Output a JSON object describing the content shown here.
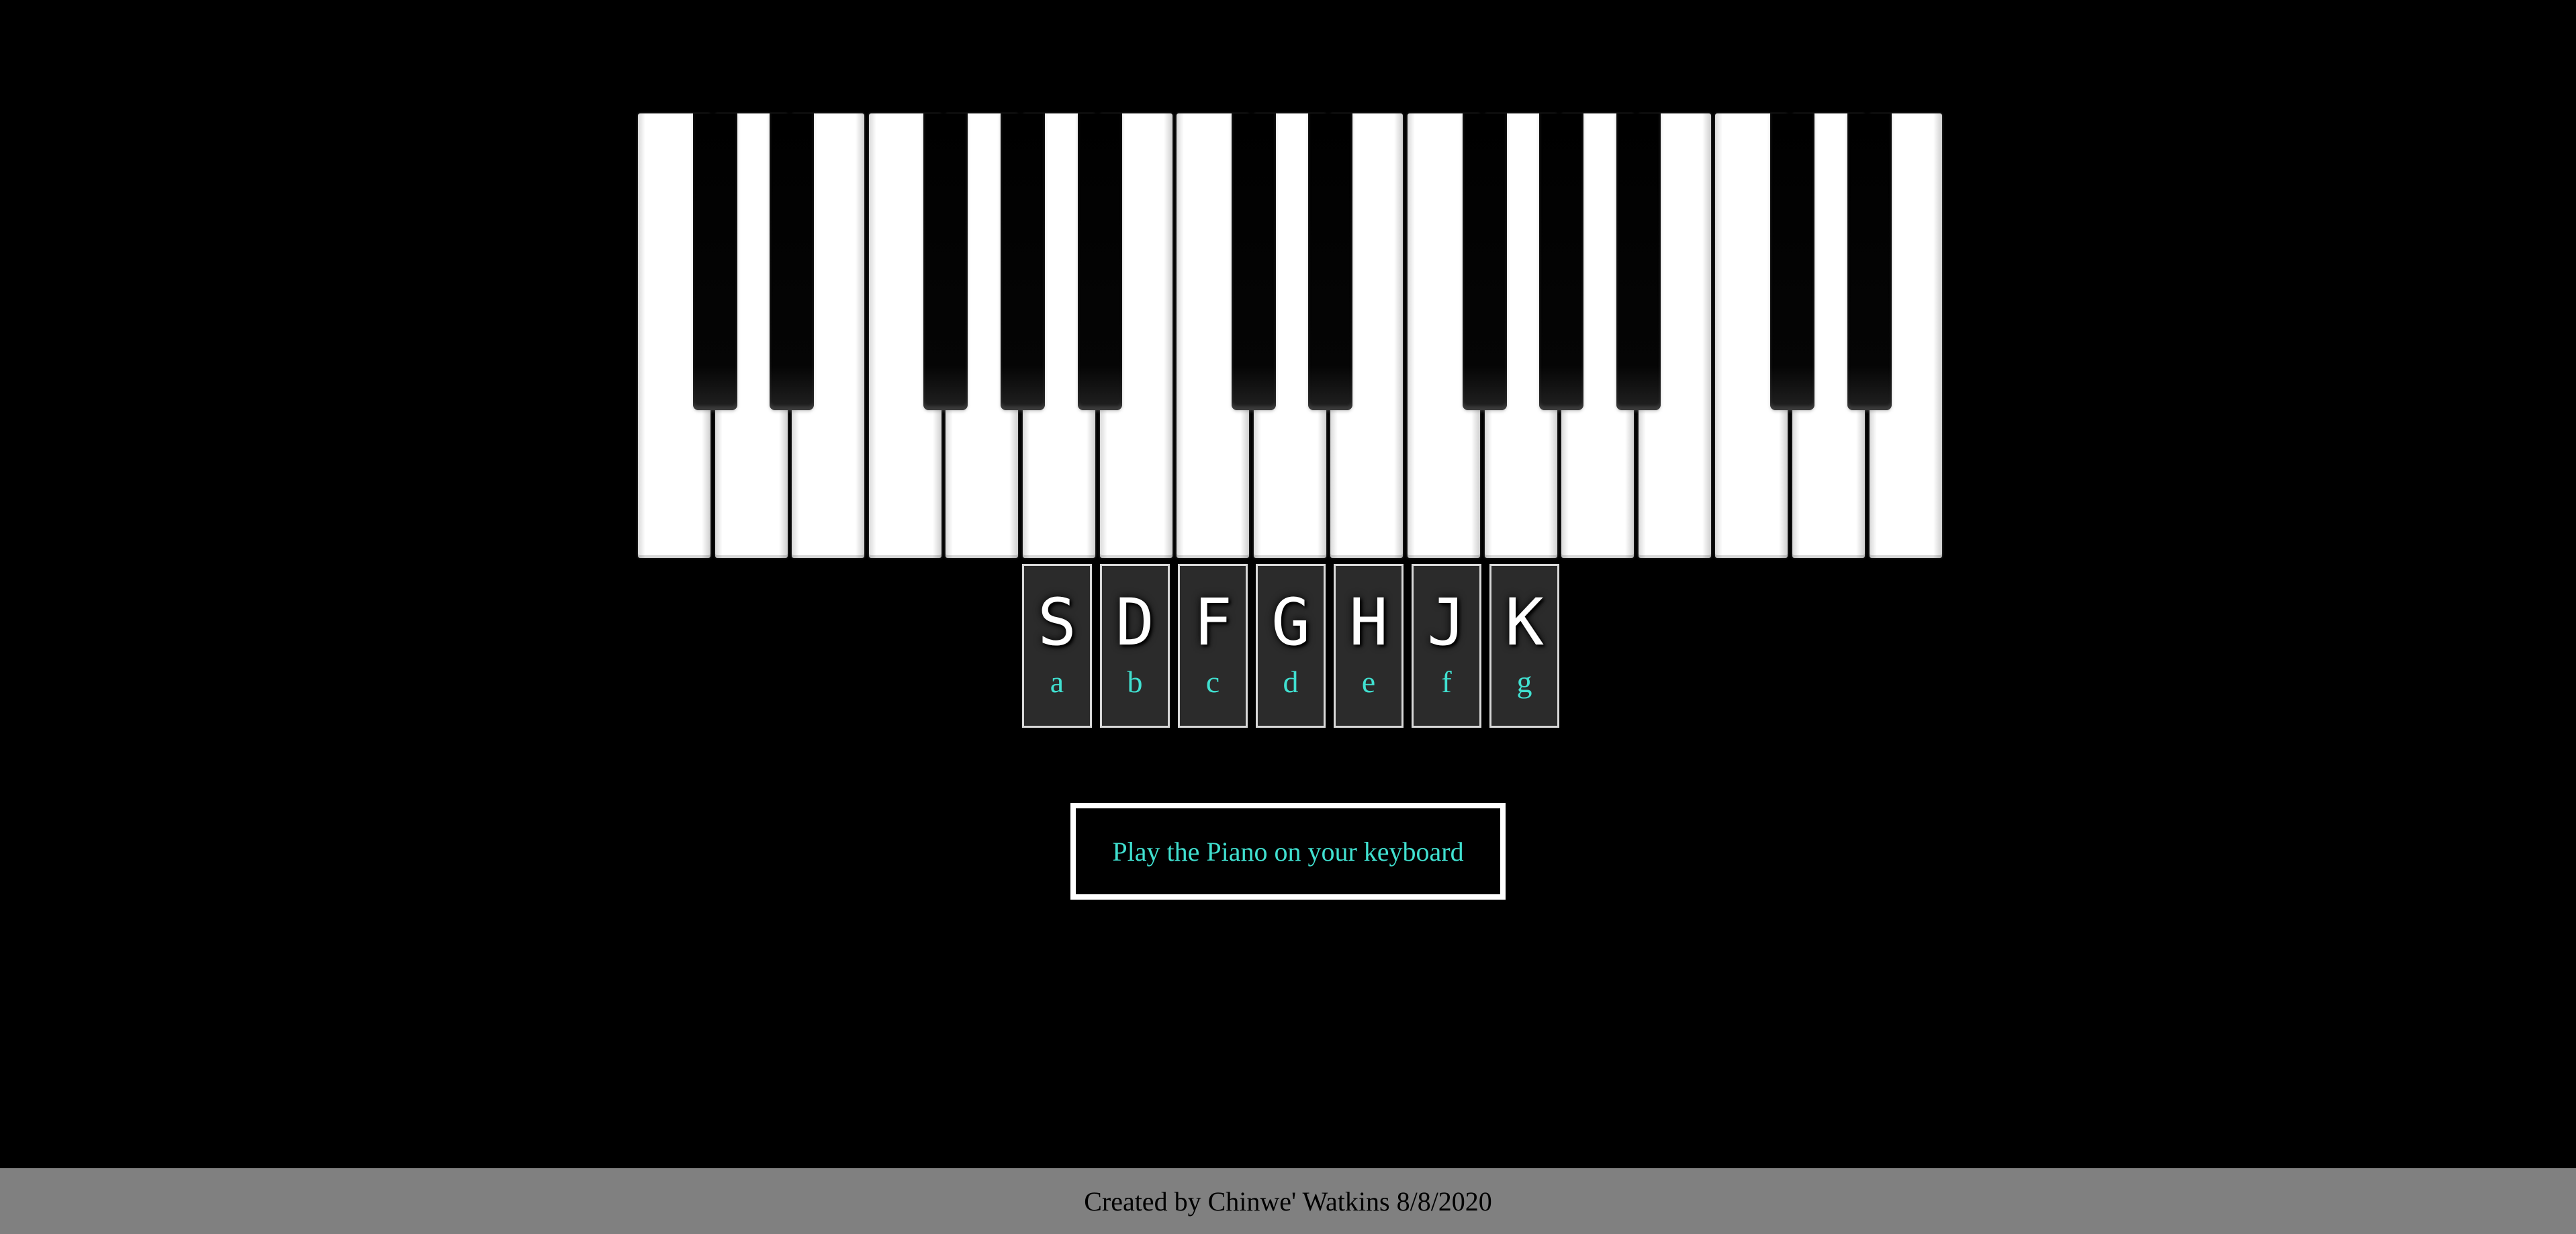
{
  "piano": {
    "white_key_count": 17,
    "black_key_count": 12
  },
  "key_hints": [
    {
      "key": "S",
      "note": "a"
    },
    {
      "key": "D",
      "note": "b"
    },
    {
      "key": "F",
      "note": "c"
    },
    {
      "key": "G",
      "note": "d"
    },
    {
      "key": "H",
      "note": "e"
    },
    {
      "key": "J",
      "note": "f"
    },
    {
      "key": "K",
      "note": "g"
    }
  ],
  "instruction": {
    "text": "Play the Piano on your keyboard"
  },
  "footer": {
    "text": "Created by Chinwe' Watkins 8/8/2020"
  },
  "colors": {
    "background": "#000000",
    "accent_teal": "#40e0d0",
    "footer_bg": "#808080",
    "hint_tile_bg": "#2b2b2b"
  }
}
